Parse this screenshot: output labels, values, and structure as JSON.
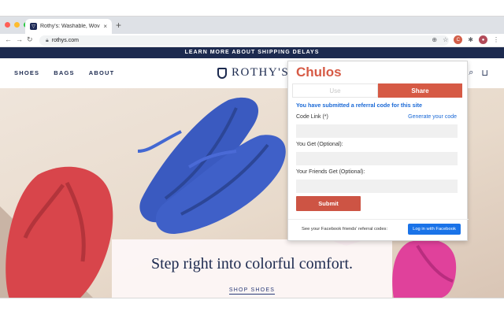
{
  "browser": {
    "tab_title": "Rothy's: Washable, Woven Fla…",
    "tab_close": "×",
    "new_tab": "+",
    "url": "rothys.com",
    "traffic_lights": [
      "#ff5f57",
      "#febc2e",
      "#28c840"
    ]
  },
  "site": {
    "announcement": "LEARN MORE ABOUT SHIPPING DELAYS",
    "nav": [
      "SHOES",
      "BAGS",
      "ABOUT"
    ],
    "logo_text": "ROTHY'S",
    "hero_title": "Step right into colorful comfort.",
    "hero_cta": "SHOP SHOES",
    "brand_color": "#1c2a4f"
  },
  "popup": {
    "brand": "Chulos",
    "tab_use": "Use",
    "tab_share": "Share",
    "notice": "You have submitted a referral code for this site",
    "code_link_label": "Code Link (*)",
    "generate_code": "Generate your code",
    "you_get_label": "You Get (Optional):",
    "friends_get_label": "Your Friends Get (Optional):",
    "submit_label": "Submit",
    "fb_prompt": "See your Facebook friends' referral codes:",
    "fb_button": "Log in with Facebook",
    "accent_color": "#d65a45",
    "link_color": "#1a69d6"
  }
}
